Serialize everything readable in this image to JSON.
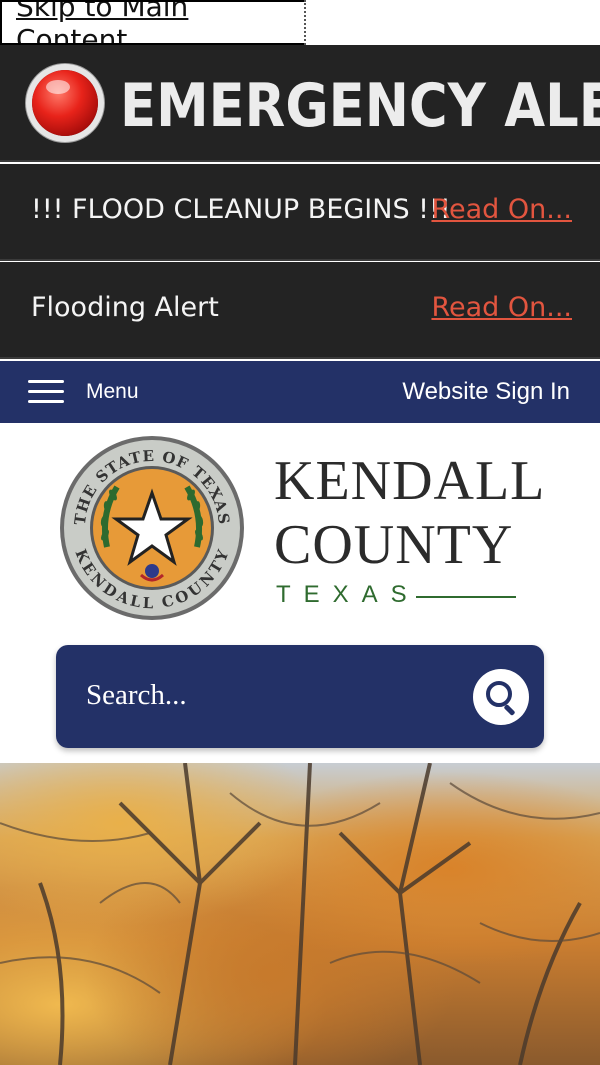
{
  "skip_link": {
    "label": "Skip to Main Content"
  },
  "emergency": {
    "title": "EMERGENCY ALERT",
    "alerts": [
      {
        "text": "!!! FLOOD CLEANUP BEGINS !!!",
        "link": "Read On..."
      },
      {
        "text": "Flooding Alert",
        "link": "Read On..."
      }
    ]
  },
  "nav": {
    "menu_label": "Menu",
    "signin_label": "Website Sign In"
  },
  "brand": {
    "line1": "KENDALL",
    "line2": "COUNTY",
    "state": "TEXAS",
    "seal_text_top": "THE STATE OF TEXAS",
    "seal_text_bottom": "KENDALL COUNTY"
  },
  "search": {
    "placeholder": "Search..."
  },
  "colors": {
    "navy": "#233167",
    "alert_bg": "#232323",
    "alert_link": "#e2553f",
    "state_green": "#2f6b2f"
  },
  "icons": {
    "menu": "hamburger-icon",
    "search": "search-icon",
    "alert": "alert-light-icon"
  }
}
